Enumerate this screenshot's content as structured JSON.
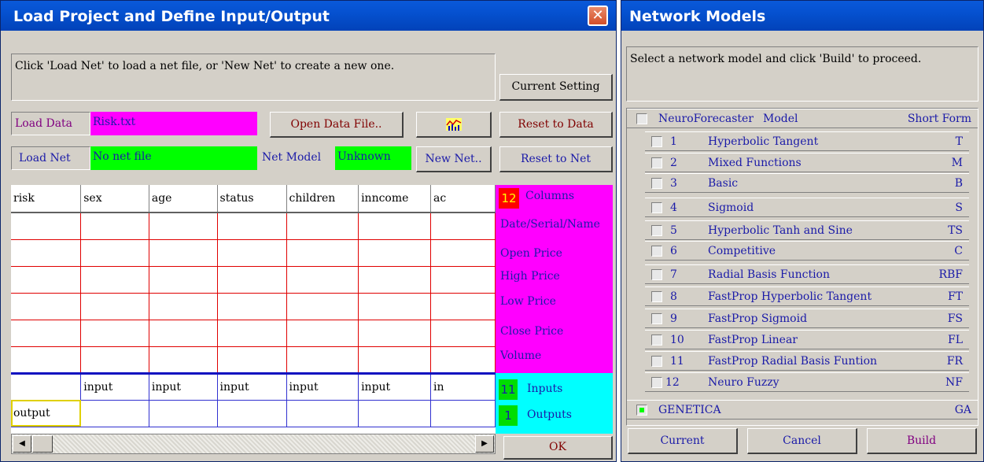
{
  "load_window": {
    "title": "Load Project and Define Input/Output",
    "close_glyph": "✕",
    "instructions": "Click 'Load Net' to load a net file, or 'New Net' to create a new one.",
    "current_setting_label": "Current Setting",
    "load_data_label": "Load Data",
    "data_file": "Risk.txt",
    "open_data_file_label": "Open Data File..",
    "chart_icon": "chart-icon",
    "reset_to_data_label": "Reset to Data",
    "load_net_label": "Load Net",
    "net_file": "No net file",
    "net_model_label": "Net Model",
    "net_model_value": "Unknown",
    "new_net_label": "New Net..",
    "reset_to_net_label": "Reset to Net",
    "grid": {
      "headers": [
        "risk",
        "sex",
        "age",
        "status",
        "children",
        "inncome",
        "ac"
      ],
      "io_row1": [
        "",
        "input",
        "input",
        "input",
        "input",
        "input",
        "in"
      ],
      "io_row2": [
        "output",
        "",
        "",
        "",
        "",
        "",
        ""
      ]
    },
    "columns_count": "12",
    "columns_label": "Columns",
    "field_labels": [
      "Date/Serial/Name",
      "Open Price",
      "High Price",
      "Low Price",
      "Close Price",
      "Volume"
    ],
    "inputs_count": "11",
    "inputs_label": "Inputs",
    "outputs_count": "1",
    "outputs_label": "Outputs",
    "ok_label": "OK",
    "scroll_left_glyph": "◀",
    "scroll_right_glyph": "▶"
  },
  "network_window": {
    "title": "Network Models",
    "instructions": "Select a network model and click 'Build' to proceed.",
    "header": {
      "name": "NeuroForecaster",
      "model": "Model",
      "short": "Short Form"
    },
    "models": [
      {
        "num": "1",
        "name": "Hyperbolic Tangent",
        "short": "T"
      },
      {
        "num": "2",
        "name": "Mixed Functions",
        "short": "M"
      },
      {
        "num": "3",
        "name": "Basic",
        "short": "B"
      },
      {
        "num": "4",
        "name": "Sigmoid",
        "short": "S"
      },
      {
        "num": "5",
        "name": "Hyperbolic Tanh and Sine",
        "short": "TS"
      },
      {
        "num": "6",
        "name": "Competitive",
        "short": "C"
      },
      {
        "num": "7",
        "name": "Radial Basis Function",
        "short": "RBF"
      },
      {
        "num": "8",
        "name": "FastProp Hyperbolic Tangent",
        "short": "FT"
      },
      {
        "num": "9",
        "name": "FastProp Sigmoid",
        "short": "FS"
      },
      {
        "num": "10",
        "name": "FastProp Linear",
        "short": "FL"
      },
      {
        "num": "11",
        "name": "FastProp Radial Basis Funtion",
        "short": "FR"
      },
      {
        "num": "12",
        "name": "Neuro Fuzzy",
        "short": "NF"
      }
    ],
    "genetica": {
      "name": "GENETICA",
      "short": "GA"
    },
    "current_label": "Current",
    "cancel_label": "Cancel",
    "build_label": "Build"
  }
}
